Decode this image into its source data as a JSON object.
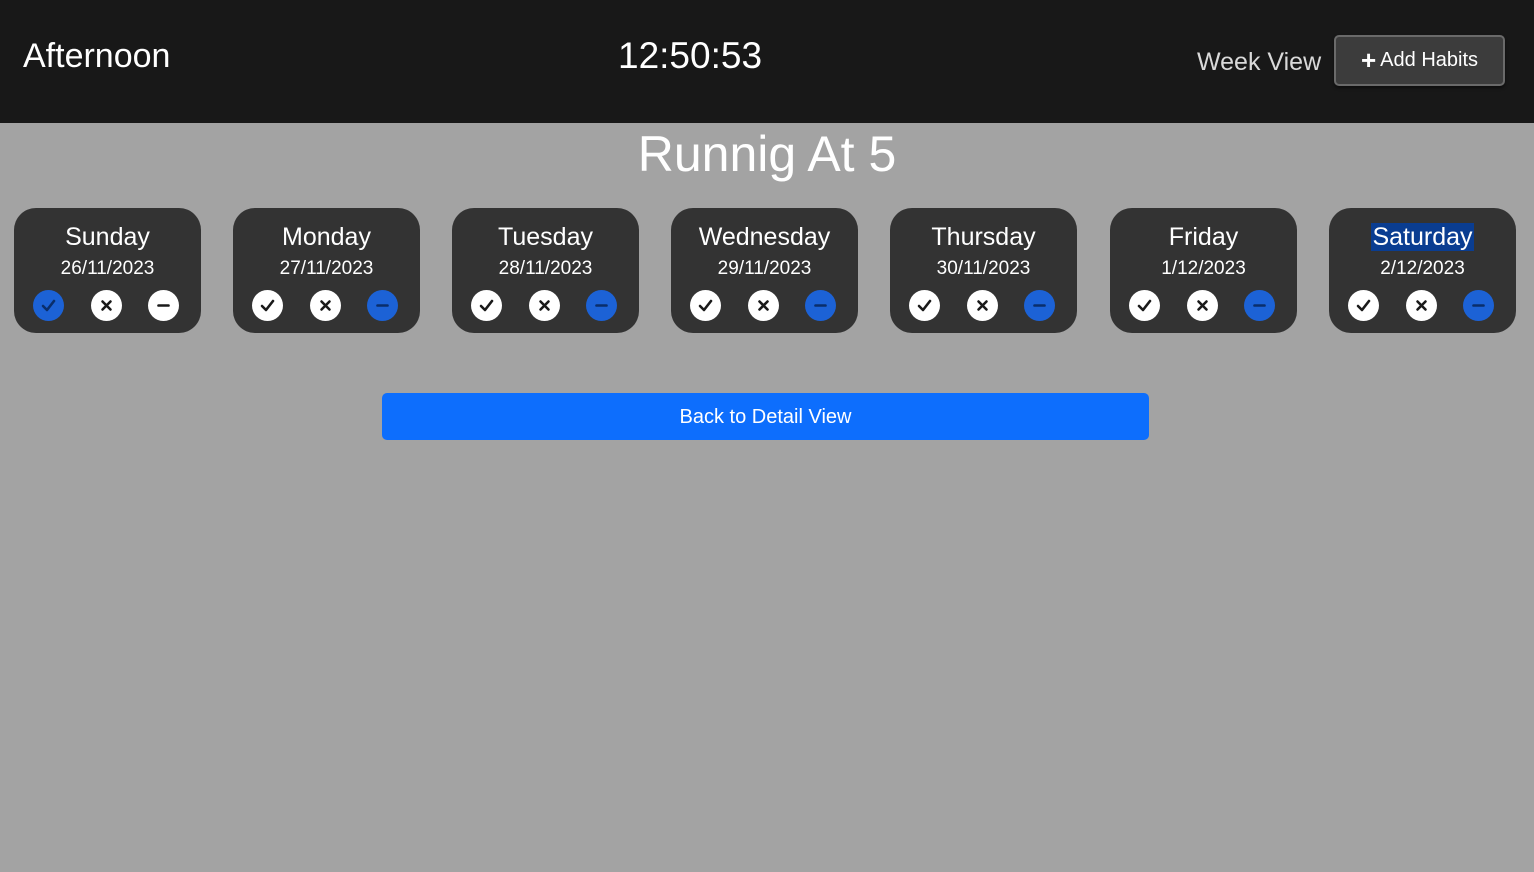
{
  "header": {
    "greeting": "Afternoon",
    "clock": "12:50:53",
    "week_view_label": "Week View",
    "add_habits_label": "Add Habits",
    "add_icon": "plus-icon"
  },
  "habit": {
    "title": "Runnig At 5"
  },
  "days": [
    {
      "name": "Sunday",
      "date": "26/11/2023",
      "status": "done",
      "selected": false
    },
    {
      "name": "Monday",
      "date": "27/11/2023",
      "status": "skipped",
      "selected": false
    },
    {
      "name": "Tuesday",
      "date": "28/11/2023",
      "status": "skipped",
      "selected": false
    },
    {
      "name": "Wednesday",
      "date": "29/11/2023",
      "status": "skipped",
      "selected": false
    },
    {
      "name": "Thursday",
      "date": "30/11/2023",
      "status": "skipped",
      "selected": false
    },
    {
      "name": "Friday",
      "date": "1/12/2023",
      "status": "skipped",
      "selected": false
    },
    {
      "name": "Saturday",
      "date": "2/12/2023",
      "status": "skipped",
      "selected": true
    }
  ],
  "status_icons": [
    "check-icon",
    "x-icon",
    "minus-icon"
  ],
  "back_button_label": "Back to Detail View",
  "colors": {
    "navbar": "#181818",
    "page": "#a3a3a3",
    "card": "#333333",
    "active_status": "#1c62d6",
    "primary_button": "#0d6efd",
    "selection": "#0a3d91"
  }
}
